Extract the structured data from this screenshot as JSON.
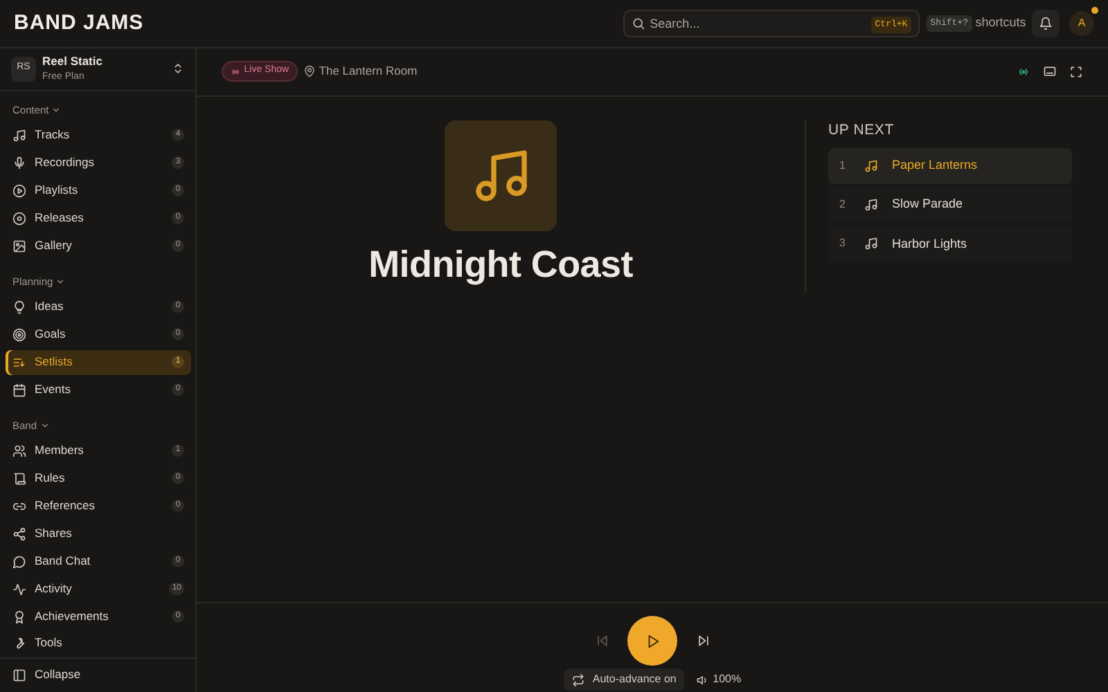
{
  "app": {
    "logo": "BAND JAMS"
  },
  "header": {
    "search": {
      "placeholder": "Search...",
      "shortcut": "Ctrl+K"
    },
    "help_key": "Shift+?",
    "help_label": "shortcuts",
    "avatar": {
      "initial": "A",
      "notification": true
    }
  },
  "team": {
    "initials": "RS",
    "name": "Reel Static",
    "plan": "Free Plan"
  },
  "sidebar": {
    "sections": [
      {
        "title": "Content",
        "expanded": true,
        "items": [
          {
            "label": "Tracks",
            "count": "4",
            "selected": false
          },
          {
            "label": "Recordings",
            "count": "3",
            "selected": false
          },
          {
            "label": "Playlists",
            "count": "0",
            "selected": false
          },
          {
            "label": "Releases",
            "count": "0",
            "selected": false
          },
          {
            "label": "Gallery",
            "count": "0",
            "selected": false
          }
        ]
      },
      {
        "title": "Planning",
        "expanded": true,
        "items": [
          {
            "label": "Ideas",
            "count": "0",
            "selected": false
          },
          {
            "label": "Goals",
            "count": "0",
            "selected": false
          },
          {
            "label": "Setlists",
            "count": "1",
            "selected": true
          },
          {
            "label": "Events",
            "count": "0",
            "selected": false
          }
        ]
      },
      {
        "title": "Band",
        "expanded": true,
        "items": [
          {
            "label": "Members",
            "count": "1",
            "selected": false
          },
          {
            "label": "Rules",
            "count": "0",
            "selected": false
          },
          {
            "label": "References",
            "count": "0",
            "selected": false
          },
          {
            "label": "Shares",
            "selected": false
          },
          {
            "label": "Band Chat",
            "count": "0",
            "selected": false
          },
          {
            "label": "Activity",
            "count": "10",
            "selected": false
          },
          {
            "label": "Achievements",
            "count": "0",
            "selected": false
          }
        ]
      }
    ],
    "tools": "Tools",
    "collapse": "Collapse"
  },
  "toolbar": {
    "badge": "Live Show",
    "venue": "The Lantern Room"
  },
  "now_playing": {
    "title": "Midnight Coast"
  },
  "up_next": {
    "heading": "UP NEXT",
    "items": [
      {
        "number": "1",
        "title": "Paper Lanterns",
        "selected": true
      },
      {
        "number": "2",
        "title": "Slow Parade",
        "selected": false
      },
      {
        "number": "3",
        "title": "Harbor Lights",
        "selected": false
      }
    ]
  },
  "player": {
    "previous_disabled": true,
    "auto_advance": "Auto-advance on",
    "volume": "100%"
  }
}
